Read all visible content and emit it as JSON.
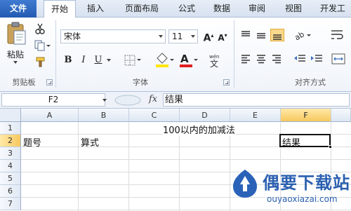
{
  "tabs": [
    {
      "label": "文件"
    },
    {
      "label": "开始"
    },
    {
      "label": "插入"
    },
    {
      "label": "页面布局"
    },
    {
      "label": "公式"
    },
    {
      "label": "数据"
    },
    {
      "label": "审阅"
    },
    {
      "label": "视图"
    },
    {
      "label": "开发工"
    }
  ],
  "ribbon": {
    "clipboard": {
      "paste_label": "粘贴",
      "group_label": "剪贴板"
    },
    "font": {
      "name": "宋体",
      "size": "11",
      "group_label": "字体"
    },
    "alignment": {
      "group_label": "对齐方式"
    }
  },
  "formula_bar": {
    "name_box": "F2",
    "fx": "fx",
    "content": "结果"
  },
  "grid": {
    "columns": [
      "A",
      "B",
      "C",
      "D",
      "E",
      "F"
    ],
    "selected_column": "F",
    "rows": [
      "1",
      "2",
      "3",
      "4",
      "5",
      "6",
      "7"
    ],
    "selected_row": "2",
    "cells": {
      "D1": "100以内的加减法",
      "A2": "题号",
      "B2": "算式",
      "F2": "结果"
    },
    "active_cell": "F2"
  },
  "watermark": {
    "title": "偶要下载站",
    "url": "ouyaoxiazai.com"
  },
  "colors": {
    "file_tab": "#2a62b8",
    "selection": "#f7c85e",
    "watermark": "#2a5fb0",
    "font_color_bar": "#e02020",
    "fill_color_bar": "#ffe600"
  }
}
